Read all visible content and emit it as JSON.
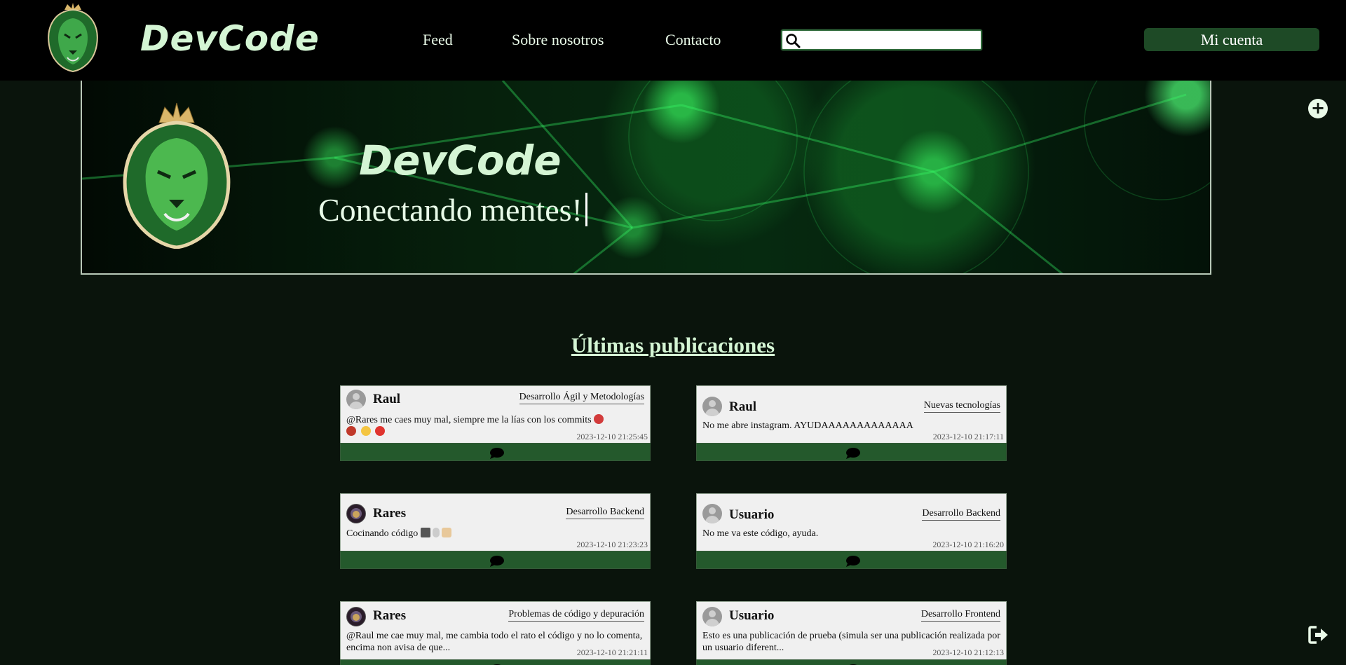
{
  "header": {
    "brand": "DevCode",
    "nav": [
      "Feed",
      "Sobre nosotros",
      "Contacto"
    ],
    "search_placeholder": "",
    "account_label": "Mi cuenta"
  },
  "banner": {
    "title": "DevCode",
    "tagline": "Conectando mentes!"
  },
  "section_title": "Últimas publicaciones",
  "posts": [
    {
      "author": "Raul",
      "category": "Desarrollo Ágil y Metodologías",
      "content": "@Rares me caes muy mal, siempre me la lías con los commits",
      "emojis": [
        "angry-face",
        "ogre",
        "flushed-face",
        "angry-red-face"
      ],
      "date": "2023-12-10 21:25:45",
      "avatar": "default"
    },
    {
      "author": "Raul",
      "category": "Nuevas tecnologías",
      "content": "No me abre instagram. AYUDAAAAAAAAAAAAA",
      "emojis": [],
      "date": "2023-12-10 21:17:11",
      "avatar": "default"
    },
    {
      "author": "Rares",
      "category": "Desarrollo Backend",
      "content": "Cocinando código",
      "emojis": [
        "laptop",
        "mouse",
        "bandage"
      ],
      "date": "2023-12-10 21:23:23",
      "avatar": "lion"
    },
    {
      "author": "Usuario",
      "category": "Desarrollo Backend",
      "content": "No me va este código, ayuda.",
      "emojis": [],
      "date": "2023-12-10 21:16:20",
      "avatar": "default"
    },
    {
      "author": "Rares",
      "category": "Problemas de código y depuración",
      "content": "@Raul me cae muy mal, me cambia todo el rato el código y no lo comenta, encima non avisa de que...",
      "emojis": [],
      "date": "2023-12-10 21:21:11",
      "avatar": "lion"
    },
    {
      "author": "Usuario",
      "category": "Desarrollo Frontend",
      "content": "Esto es una publicación de prueba (simula ser una publicación realizada por un usuario diferent...",
      "emojis": [],
      "date": "2023-12-10 21:12:13",
      "avatar": "default"
    }
  ],
  "icons": {
    "search": "search-icon",
    "add": "plus-circle-icon",
    "logout": "logout-icon",
    "comment": "comment-icon"
  },
  "colors": {
    "header_bg": "#000000",
    "page_bg": "#0a140c",
    "accent": "#1e4a26",
    "post_footer": "#24592c",
    "brand_text": "#d4f5d4"
  }
}
